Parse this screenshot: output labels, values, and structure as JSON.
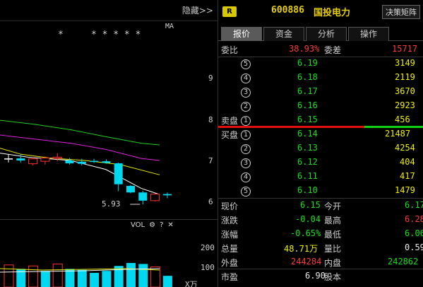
{
  "chart": {
    "hide_label": "隐藏>>",
    "ma_label": "MA",
    "stars": "*     * * * * *",
    "price_ticks": [
      "9",
      "8",
      "7",
      "6"
    ],
    "low_marker": "5.93",
    "vol_label": "VOL",
    "vol_ticks": [
      "200",
      "100"
    ],
    "vol_unit": "X万",
    "colors": {
      "up": "#ff3030",
      "down": "#00d8f0",
      "ma_green": "#20d020",
      "ma_magenta": "#e020e0",
      "ma_yellow": "#e8e800",
      "ma_white": "#ffffff"
    }
  },
  "chart_data": {
    "type": "candlestick",
    "candles": [
      {
        "o": 7.05,
        "h": 7.15,
        "l": 6.95,
        "c": 7.05,
        "dir": "flat"
      },
      {
        "o": 7.05,
        "h": 7.15,
        "l": 6.95,
        "c": 7.0,
        "dir": "down"
      },
      {
        "o": 6.92,
        "h": 7.08,
        "l": 6.88,
        "c": 7.04,
        "dir": "up"
      },
      {
        "o": 6.98,
        "h": 7.1,
        "l": 6.9,
        "c": 7.06,
        "dir": "up"
      },
      {
        "o": 7.05,
        "h": 7.18,
        "l": 6.98,
        "c": 7.08,
        "dir": "up"
      },
      {
        "o": 7.0,
        "h": 7.06,
        "l": 6.9,
        "c": 6.93,
        "dir": "down"
      },
      {
        "o": 6.97,
        "h": 7.04,
        "l": 6.88,
        "c": 6.92,
        "dir": "down"
      },
      {
        "o": 6.99,
        "h": 7.04,
        "l": 6.94,
        "c": 6.97,
        "dir": "down"
      },
      {
        "o": 6.98,
        "h": 7.03,
        "l": 6.92,
        "c": 6.94,
        "dir": "down"
      },
      {
        "o": 6.93,
        "h": 6.95,
        "l": 6.25,
        "c": 6.42,
        "dir": "down"
      },
      {
        "o": 6.38,
        "h": 6.4,
        "l": 6.2,
        "c": 6.22,
        "dir": "down"
      },
      {
        "o": 6.22,
        "h": 6.26,
        "l": 5.93,
        "c": 6.02,
        "dir": "down"
      },
      {
        "o": 6.02,
        "h": 6.2,
        "l": 6.0,
        "c": 6.18,
        "dir": "up"
      },
      {
        "o": 6.18,
        "h": 6.22,
        "l": 6.08,
        "c": 6.15,
        "dir": "down"
      }
    ],
    "volumes": [
      {
        "v": 115,
        "dir": "up"
      },
      {
        "v": 95,
        "dir": "down"
      },
      {
        "v": 110,
        "dir": "up"
      },
      {
        "v": 85,
        "dir": "down"
      },
      {
        "v": 120,
        "dir": "up"
      },
      {
        "v": 95,
        "dir": "down"
      },
      {
        "v": 90,
        "dir": "down"
      },
      {
        "v": 75,
        "dir": "down"
      },
      {
        "v": 85,
        "dir": "down"
      },
      {
        "v": 110,
        "dir": "down"
      },
      {
        "v": 125,
        "dir": "down"
      },
      {
        "v": 120,
        "dir": "down"
      },
      {
        "v": 105,
        "dir": "up"
      },
      {
        "v": 60,
        "dir": "down"
      }
    ],
    "ylim": [
      5.7,
      9.4
    ],
    "vol_ylim": [
      0,
      240
    ]
  },
  "panel": {
    "badge": "R",
    "code": "600886",
    "name": "国投电力",
    "decision_btn": "决策矩阵",
    "tabs": [
      "报价",
      "资金",
      "分析",
      "操作"
    ],
    "weibi_label": "委比",
    "weibi_value": "38.93%",
    "weicha_label": "委差",
    "weicha_value": "15717",
    "sell_label": "卖盘",
    "buy_label": "买盘",
    "sells": [
      {
        "n": "5",
        "price": "6.19",
        "vol": "3149"
      },
      {
        "n": "4",
        "price": "6.18",
        "vol": "2119"
      },
      {
        "n": "3",
        "price": "6.17",
        "vol": "3670"
      },
      {
        "n": "2",
        "price": "6.16",
        "vol": "2923"
      },
      {
        "n": "1",
        "price": "6.15",
        "vol": "456"
      }
    ],
    "buys": [
      {
        "n": "1",
        "price": "6.14",
        "vol": "21487"
      },
      {
        "n": "2",
        "price": "6.13",
        "vol": "4254"
      },
      {
        "n": "3",
        "price": "6.12",
        "vol": "404"
      },
      {
        "n": "4",
        "price": "6.11",
        "vol": "417"
      },
      {
        "n": "5",
        "price": "6.10",
        "vol": "1479"
      }
    ],
    "stats": [
      {
        "l1": "现价",
        "v1": "6.15",
        "c1": "green",
        "l2": "今开",
        "v2": "6.17",
        "c2": "green"
      },
      {
        "l1": "涨跌",
        "v1": "-0.04",
        "c1": "green",
        "l2": "最高",
        "v2": "6.28",
        "c2": "red"
      },
      {
        "l1": "涨幅",
        "v1": "-0.65%",
        "c1": "green",
        "l2": "最低",
        "v2": "6.06",
        "c2": "green"
      },
      {
        "l1": "总量",
        "v1": "48.71万",
        "c1": "yellow",
        "l2": "量比",
        "v2": "0.59",
        "c2": "white"
      },
      {
        "l1": "外盘",
        "v1": "244284",
        "c1": "red",
        "l2": "内盘",
        "v2": "242862",
        "c2": "green"
      },
      {
        "l1": "市盈",
        "v1": "6.90",
        "c1": "white",
        "l2": "股本",
        "v2": "",
        "c2": "white"
      }
    ]
  }
}
